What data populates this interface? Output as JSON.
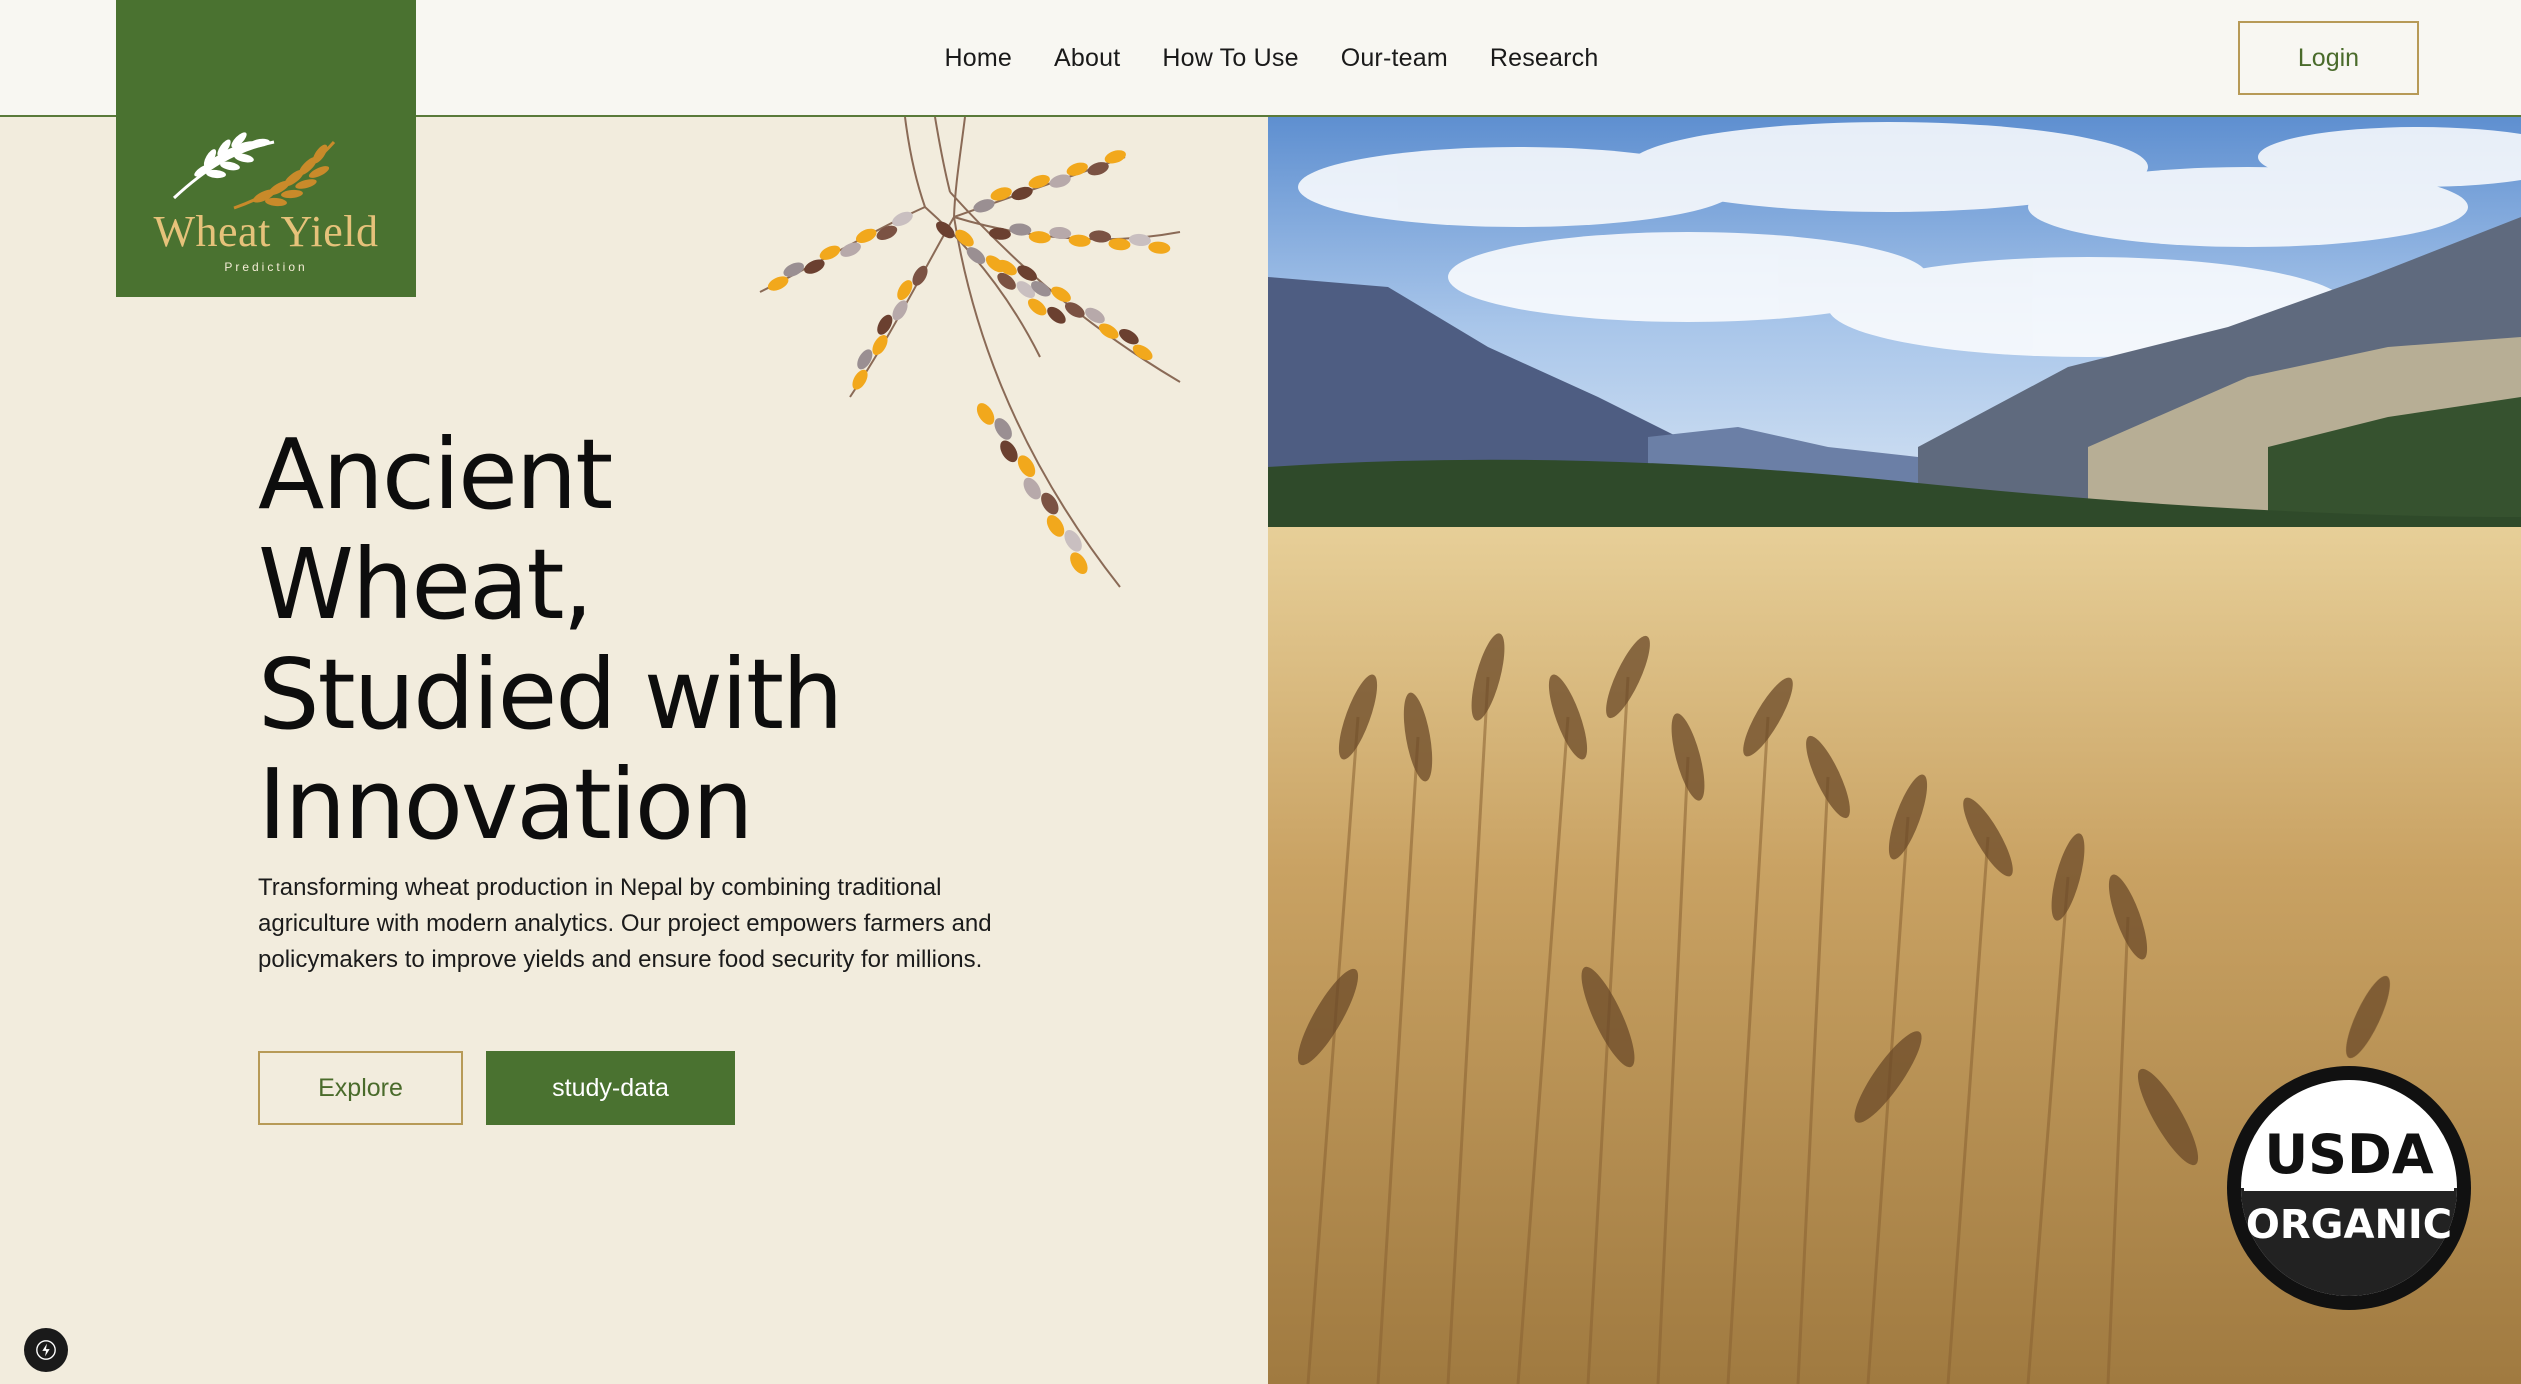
{
  "brand": {
    "title": "Wheat Yield",
    "subtitle": "Prediction"
  },
  "nav": {
    "items": [
      {
        "label": "Home"
      },
      {
        "label": "About"
      },
      {
        "label": "How To Use"
      },
      {
        "label": "Our-team"
      },
      {
        "label": "Research"
      }
    ],
    "login_label": "Login"
  },
  "hero": {
    "title_lines": [
      "Ancient",
      "Wheat,",
      "Studied with",
      "Innovation"
    ],
    "description": "Transforming wheat production in Nepal by combining traditional agriculture with modern analytics. Our project empowers farmers and policymakers to improve yields and ensure food security for millions.",
    "explore_label": "Explore",
    "study_label": "study-data"
  },
  "badge": {
    "top": "USDA",
    "bottom": "ORGANIC"
  },
  "colors": {
    "brand_green": "#4a7230",
    "cream_bg": "#f2ecdd",
    "header_bg": "#f8f7f2",
    "gold": "#b79a57"
  },
  "icons": {
    "logo": "wheat-stalk-icon",
    "decoration": "wheat-branch-icon",
    "dev": "lightning-bolt-icon"
  }
}
